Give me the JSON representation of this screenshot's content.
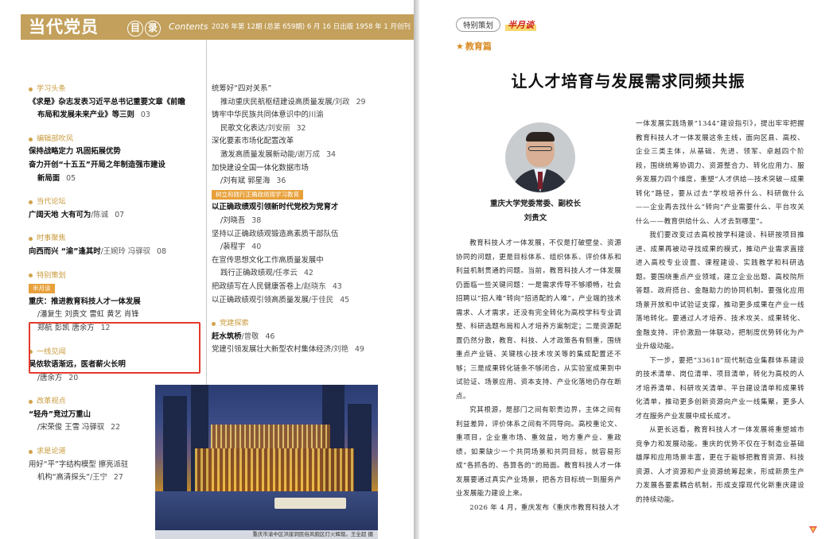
{
  "header": {
    "mag_title": "当代党员",
    "mulu_a": "目",
    "mulu_b": "录",
    "contents_en": "Contents",
    "issue_info": "2026 年第 12期 (总第 659期)  6 月 16 日出版   1958 年 1 月创刊"
  },
  "toc_left": {
    "xuexi": {
      "head": "学习头条",
      "line1": "《求是》杂志发表习近平总书记重要文章《前瞻",
      "line2": "布局和发展未来产业》等三则",
      "pg": "03"
    },
    "bianji": {
      "head": "编辑部吹风",
      "line1": "保持战略定力   巩固拓展优势",
      "line2": "奋力开创“十五五”开局之年制造强市建设",
      "line3": "新局面",
      "pg": "05"
    },
    "luntan": {
      "head": "当代论坛",
      "line1": "广阔天地   大有可为",
      "author": "/陈诚",
      "pg": "07"
    },
    "shishi": {
      "head": "时事聚焦",
      "line1": "向西而兴   “渝”逢其时",
      "author": "/王婉玲   冯驿驭",
      "pg": "08"
    },
    "tebie": {
      "head": "特别策划",
      "tag": "半月谈",
      "line1": "重庆：推进教育科技人才一体发展",
      "line2": "/潘复生   刘贵文   雷虹   黄艺   肖锋",
      "line3": "郑航   彭凯   唐余方",
      "pg": "12"
    },
    "yixian": {
      "head": "一线见闻",
      "line1": "吴侬软语渐远，医者薪火长明",
      "author": "/唐余方",
      "pg": "20"
    },
    "gaige": {
      "head": "改革视点",
      "line1": "“轻舟”竞过万重山",
      "author": "/宋荣俊   王雪   冯驿驭",
      "pg": "22"
    },
    "qiushi": {
      "head": "求是论道",
      "line1": "用好“平”字结构模型   擦亮派驻",
      "line2": "机构“高清探头”",
      "author": "/王宁",
      "pg": "27"
    }
  },
  "toc_right": {
    "l1": "统筹好“四对关系”",
    "l2": "推动重庆民航枢纽建设高质量发展",
    "l2a": "/刘政",
    "l2p": "29",
    "l3": "铸牢中华民族共同体意识中的川渝",
    "l4": "民歌文化表达",
    "l4a": "/刘安丽",
    "l4p": "32",
    "l5": "深化要素市场化配置改革",
    "l6": "激发高质量发展新动能",
    "l6a": "/谢万成",
    "l6p": "34",
    "l7": "加快建设全国一体化数据市场",
    "l8": "/刘有斌   郭星海",
    "l8p": "36",
    "tag": "树立和践行正确政绩观学习教育",
    "l9": "以正确政绩观引领新时代党校为党育才",
    "l10": "/刘晓吾",
    "l10p": "38",
    "l11": "坚持以正确政绩观锻造高素质干部队伍",
    "l12": "/裴程宇",
    "l12p": "40",
    "l13": "在宣传思想文化工作高质量发展中",
    "l14": "践行正确政绩观",
    "l14a": "/任孝云",
    "l14p": "42",
    "l15": "把政绩写在人民健康答卷上",
    "l15a": "/赵晓东",
    "l15p": "43",
    "l16": "以正确政绩观引领高质量发展",
    "l16a": "/于佳民",
    "l16p": "45",
    "dangjian_head": "党建探索",
    "l17": "赶水筑桥",
    "l17a": "/曾敬",
    "l17p": "46",
    "l18": "党建引领发展壮大新型农村集体经济",
    "l18a": "/刘艳",
    "l18p": "49"
  },
  "photo": {
    "caption": "重庆市渝中区洪崖洞民俗风貌区灯火辉煌。王全超 摄"
  },
  "article": {
    "tab_special": "特别策划",
    "tab_monthly": "半月谈",
    "section": "教育篇",
    "title": "让人才培育与发展需求同频共振",
    "bio_title": "重庆大学党委常委、副校长",
    "bio_name": "刘贵文",
    "col1_p1": "教育科技人才一体发展，不仅是打破壁垒、资源协同的问题，更是目标体系、组织体系、评价体系和利益机制贯通的问题。当前，教育科技人才一体发展仍面临一些关键问题：一是需求传导不够顺畅，社会招聘以“招人难”转向“招适配的人难”，产业端的技术需求、人才需求，还没有完全转化为高校学科专业调整、科研选题布局和人才培养方案制定；二是资源配置仍然分散，教育、科技、人才政策各有侧重，围绕重点产业链、关键核心技术攻关等的集成配置还不够；三是成果转化链条不够闭合，从实验室成果到中试验证、场景应用、资本支持、产业化落地仍存在断点。",
    "col1_p2": "究其根源，是部门之间有职责边界，主体之间有利益差异，评价体系之间有不同导向。高校重论文、重项目，企业重市场、重效益，地方重产业、重政绩，如果缺少一个共同场景和共同目标，就容易形成“各抓各的、各算各的”的局面。教育科技人才一体发展要通过真实产业场景，把各方目标统一到服务产业发展能力建设上来。",
    "col1_p3": "2026 年 4 月，重庆发布《重庆市教育科技人才",
    "col2_p1": "一体发展实践场景“1344”建设指引》，提出牢牢把握教育科技人才一体发展这条主线，面向区县、高校、企业三类主体，从基础、先进、领军、卓越四个阶段，围绕统筹协调力、资源整合力、转化应用力、服务发展力四个维度，重塑“人才供给—技术突破—成果转化”路径，要从过去“学校培养什么、科研做什么——企业再去找什么”转向“产业需要什么、平台攻关什么——教育供给什么、人才去到哪里”。",
    "col2_p2": "我们要改变过去高校按学科建设、科研按项目推进、成果再被动寻找成果的模式，推动产业需求直接进入高校专业设置、课程建设、实践教学和科研选题。要围绕重点产业领域，建立企业出题、高校院所答题、政府搭台、金融助力的协同机制。要强化应用场景开放和中试验证支撑，推动更多成果在产业一线落地转化。要通过人才培养、技术攻关、成果转化、金融支持、评价激励一体联动，把制度优势转化为产业升级动能。",
    "col2_p3": "下一步，要把“33618”现代制造业集群体系建设的技术清单、岗位清单、项目清单，转化为高校的人才培养清单、科研攻关清单、平台建设清单和成果转化清单，推动更多创新资源向产业一线集聚，更多人才在服务产业发展中成长成才。",
    "col2_p4": "从更长远看，教育科技人才一体发展将重塑城市竞争力和发展动能。重庆的优势不仅在于制造业基础雄厚和应用场景丰富，更在于能够把教育资源、科技资源、人才资源和产业资源统筹起来，形成新质生产力发展各要素耦合机制，形成支撑现代化新重庆建设的持续动能。"
  }
}
